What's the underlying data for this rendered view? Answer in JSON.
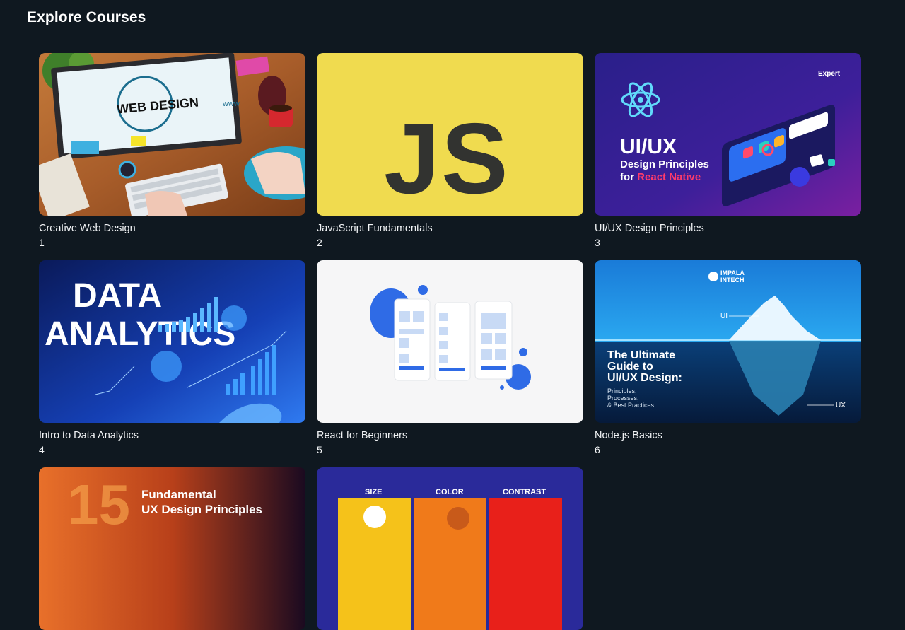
{
  "page": {
    "title": "Explore Courses"
  },
  "courses": [
    {
      "title": "Creative Web Design",
      "number": "1",
      "thumb": {
        "text": "WEB DESIGN",
        "subtext": "www"
      }
    },
    {
      "title": "JavaScript Fundamentals",
      "number": "2",
      "thumb": {
        "text": "JS",
        "bg": "#f0db4f"
      }
    },
    {
      "title": "UI/UX Design Principles",
      "number": "3",
      "thumb": {
        "brand": "Expert",
        "heading": "UI/UX",
        "line1": "Design Principles",
        "line2a": "for ",
        "line2b": "React Native"
      }
    },
    {
      "title": "Intro to Data Analytics",
      "number": "4",
      "thumb": {
        "line1": "DATA",
        "line2": "ANALYTICS"
      }
    },
    {
      "title": "React for Beginners",
      "number": "5",
      "thumb": {}
    },
    {
      "title": "Node.js Basics",
      "number": "6",
      "thumb": {
        "brand1": "IMPALA",
        "brand2": "INTECH",
        "ui": "UI",
        "ux": "UX",
        "h1": "The Ultimate",
        "h2": "Guide to",
        "h3": "UI/UX Design:",
        "s1": "Principles,",
        "s2": "Processes,",
        "s3": "& Best Practices"
      }
    },
    {
      "title": "",
      "number": "",
      "thumb": {
        "num": "15",
        "l1": "Fundamental",
        "l2": "UX Design Principles"
      }
    },
    {
      "title": "",
      "number": "",
      "thumb": {
        "c1": "SIZE",
        "c2": "COLOR",
        "c3": "CONTRAST"
      }
    }
  ]
}
